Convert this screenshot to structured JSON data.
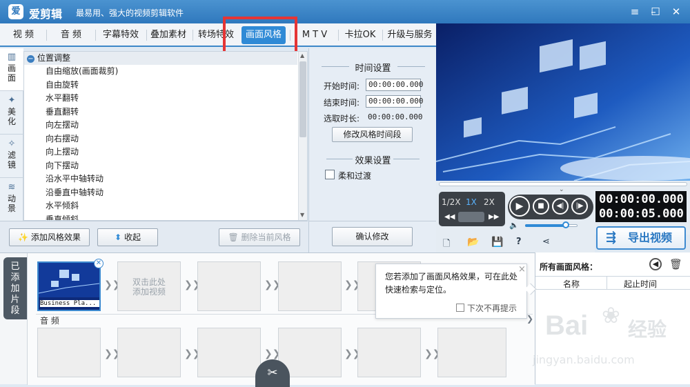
{
  "app": {
    "title": "爱剪辑",
    "slogan": "最易用、强大的视频剪辑软件",
    "logo_char": "爱"
  },
  "window_controls": {
    "menu": "≡",
    "minimize": "–",
    "maximize": "☐",
    "close": "✕"
  },
  "tabs": [
    {
      "label": "视  频"
    },
    {
      "label": "音  频"
    },
    {
      "label": "字幕特效"
    },
    {
      "label": "叠加素材"
    },
    {
      "label": "转场特效"
    },
    {
      "label": "画面风格",
      "active": true
    },
    {
      "label": "M T V"
    },
    {
      "label": "卡拉OK"
    },
    {
      "label": "升级与服务"
    }
  ],
  "side_tabs": [
    {
      "label": "画\n面",
      "icon": "screen-icon",
      "glyph": "▥"
    },
    {
      "label": "美\n化",
      "icon": "beautify-icon",
      "glyph": "✦"
    },
    {
      "label": "滤\n镜",
      "icon": "filter-icon",
      "glyph": "✧"
    },
    {
      "label": "动\n景",
      "icon": "motion-icon",
      "glyph": "≋"
    }
  ],
  "effect_list": {
    "group": "位置调整",
    "items": [
      "自由缩放(画面裁剪)",
      "自由旋转",
      "水平翻转",
      "垂直翻转",
      "向左摆动",
      "向右摆动",
      "向上摆动",
      "向下摆动",
      "沿水平中轴转动",
      "沿垂直中轴转动",
      "水平倾斜",
      "垂直倾斜"
    ]
  },
  "buttons": {
    "add_style": "添加风格效果",
    "collapse": "收起",
    "delete_style": "删除当前风格",
    "edit_time": "修改风格时间段",
    "confirm": "确认修改"
  },
  "time_settings": {
    "title": "时间设置",
    "start_label": "开始时间:",
    "start_value": "00:00:00.000",
    "end_label": "结束时间:",
    "end_value": "00:00:00.000",
    "duration_label": "选取时长:",
    "duration_value": "00:00:00.000"
  },
  "effect_settings": {
    "title": "效果设置",
    "smooth_label": "柔和过渡",
    "smooth_checked": false
  },
  "player": {
    "speeds": [
      "1/2X",
      "1X",
      "2X"
    ],
    "active_speed": "1X",
    "current_time": "00:00:00.000",
    "total_time": "00:00:05.000",
    "volume": 0.78,
    "progress": 0.0
  },
  "export": {
    "label": "导出视频"
  },
  "timeline": {
    "side_label": "已\n添\n加\n片\n段",
    "clip_name": "Business Pla...",
    "placeholder": "双击此处\n添加视频",
    "audio_label": "音  频"
  },
  "tooltip": {
    "text": "您若添加了画面风格效果，可在此处快速检索与定位。",
    "checkbox_label": "下次不再提示",
    "close": "×"
  },
  "right_panel": {
    "title": "所有画面风格：",
    "col_name": "名称",
    "col_time": "起止时间"
  },
  "watermark": {
    "brand": "Bai",
    "brand2": "经验",
    "url": "jingyan.baidu.com"
  },
  "colors": {
    "accent": "#2f8ad6",
    "titlebar": "#3a84c7",
    "highlight": "#e53535",
    "preview_bg": "#0b2a7a"
  }
}
